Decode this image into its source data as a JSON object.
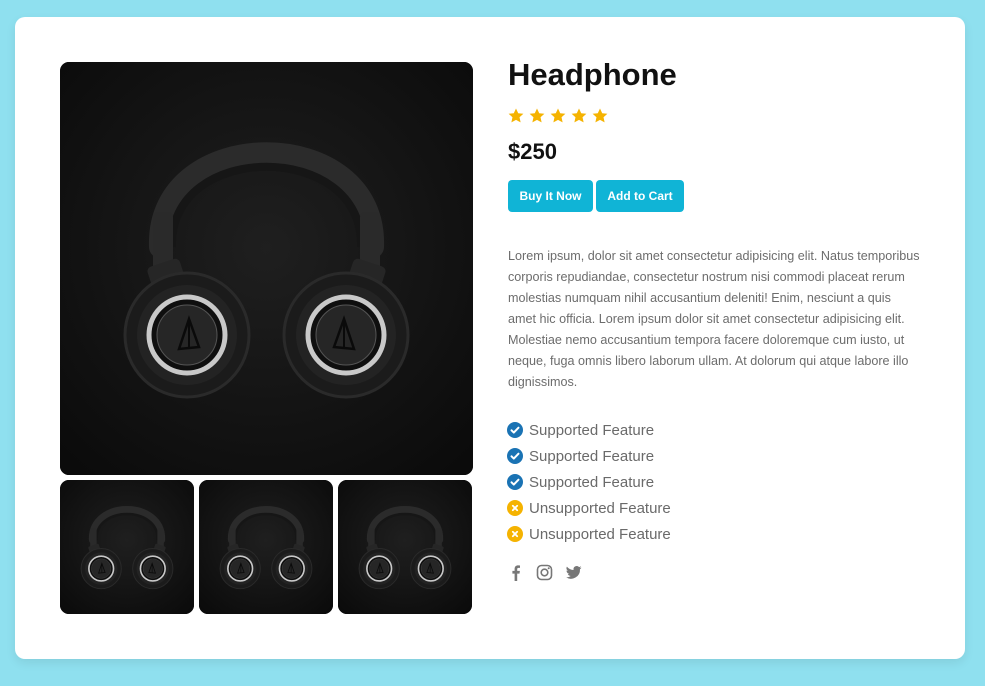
{
  "product": {
    "title": "Headphone",
    "rating": 5,
    "rating_max": 5,
    "price": "$250",
    "image_icon": "headphones-image"
  },
  "actions": {
    "buy_label": "Buy It Now",
    "cart_label": "Add to Cart"
  },
  "description": "Lorem ipsum, dolor sit amet consectetur adipisicing elit. Natus temporibus corporis repudiandae, consectetur nostrum nisi commodi placeat rerum molestias numquam nihil accusantium deleniti! Enim, nesciunt a quis amet hic officia. Lorem ipsum dolor sit amet consectetur adipisicing elit. Molestiae nemo accusantium tempora facere doloremque cum iusto, ut neque, fuga omnis libero laborum ullam. At dolorum qui atque labore illo dignissimos.",
  "features": [
    {
      "label": "Supported Feature",
      "supported": true,
      "icon": "check-circle-icon"
    },
    {
      "label": "Supported Feature",
      "supported": true,
      "icon": "check-circle-icon"
    },
    {
      "label": "Supported Feature",
      "supported": true,
      "icon": "check-circle-icon"
    },
    {
      "label": "Unsupported Feature",
      "supported": false,
      "icon": "x-circle-icon"
    },
    {
      "label": "Unsupported Feature",
      "supported": false,
      "icon": "x-circle-icon"
    }
  ],
  "social": [
    "facebook-icon",
    "instagram-icon",
    "twitter-icon"
  ],
  "colors": {
    "background": "#8fe0ef",
    "card": "#ffffff",
    "accent_button": "#10b4d6",
    "star": "#f5b301",
    "supported": "#1a73b4",
    "unsupported": "#f5b301",
    "text_muted": "#6c6c6c",
    "social_icon": "#777777"
  }
}
